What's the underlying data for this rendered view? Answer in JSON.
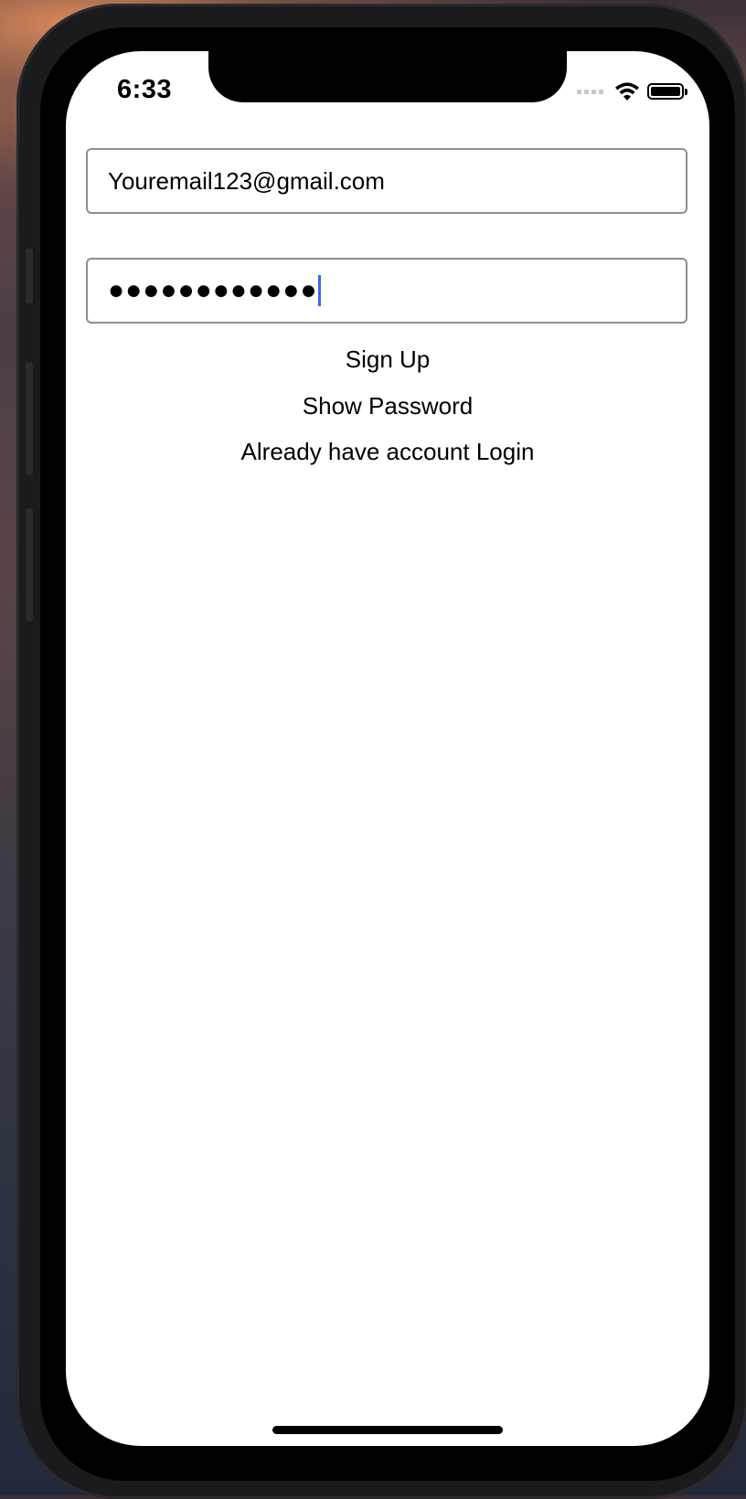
{
  "status_bar": {
    "time": "6:33",
    "icons": [
      "cellular-signal-icon",
      "wifi-icon",
      "battery-icon"
    ]
  },
  "form": {
    "email": {
      "value": "Youremail123@gmail.com"
    },
    "password": {
      "masked_value": "●●●●●●●●●●●●",
      "caret_color": "#3f66e6"
    }
  },
  "actions": {
    "sign_up": "Sign Up",
    "show_password": "Show Password",
    "login": "Already have account Login"
  },
  "colors": {
    "screen_background": "#ffffff",
    "field_border": "#8e8e93",
    "text": "#000000"
  }
}
